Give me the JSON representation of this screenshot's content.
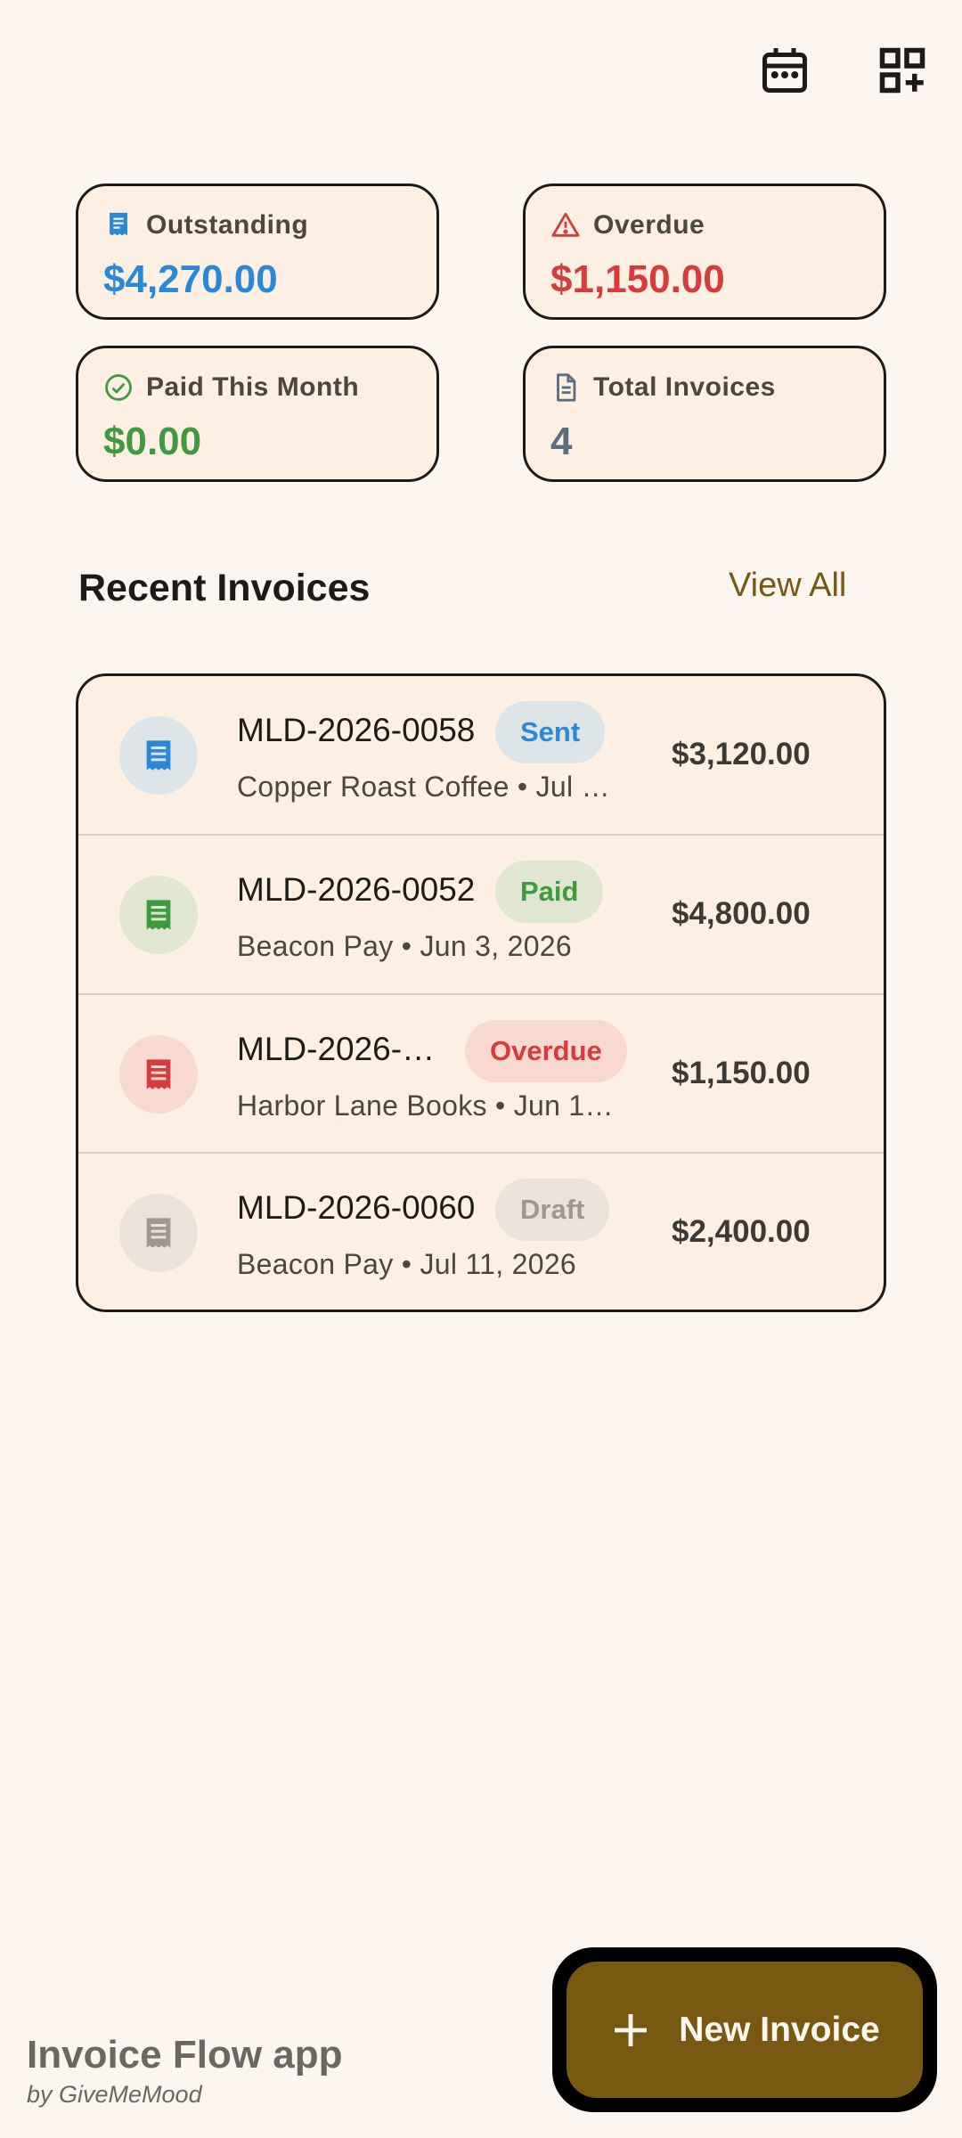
{
  "toolbar": {
    "calendar_icon": "calendar-icon",
    "add_widget_icon": "dashboard-add-icon"
  },
  "stats": {
    "outstanding": {
      "label": "Outstanding",
      "value": "$4,270.00",
      "icon": "receipt-icon",
      "color": "#2a88d8"
    },
    "overdue": {
      "label": "Overdue",
      "value": "$1,150.00",
      "icon": "warning-icon",
      "color": "#d83b3b"
    },
    "paid": {
      "label": "Paid This Month",
      "value": "$0.00",
      "icon": "check-circle-icon",
      "color": "#3f9a41"
    },
    "total": {
      "label": "Total Invoices",
      "value": "4",
      "icon": "document-icon",
      "color": "#5a6e80"
    }
  },
  "recent": {
    "title": "Recent Invoices",
    "view_all": "View All"
  },
  "invoices": [
    {
      "number": "MLD-2026-0058",
      "status": "Sent",
      "subtitle": "Copper Roast Coffee • Jul …",
      "amount": "$3,120.00",
      "color": "#2a88d8",
      "bg": "#dde4e8"
    },
    {
      "number": "MLD-2026-0052",
      "status": "Paid",
      "subtitle": "Beacon Pay • Jun 3, 2026",
      "amount": "$4,800.00",
      "color": "#3f9a41",
      "bg": "#e0e6cf"
    },
    {
      "number": "MLD-2026-0…",
      "status": "Overdue",
      "subtitle": "Harbor Lane Books • Jun 1…",
      "amount": "$1,150.00",
      "color": "#d83b3b",
      "bg": "#f7d9d0"
    },
    {
      "number": "MLD-2026-0060",
      "status": "Draft",
      "subtitle": "Beacon Pay • Jul 11, 2026",
      "amount": "$2,400.00",
      "color": "#9d9891",
      "bg": "#ebe3d9"
    }
  ],
  "fab": {
    "label": "New Invoice",
    "icon": "plus-icon"
  },
  "brand": {
    "title": "Invoice Flow app",
    "subtitle": "by GiveMeMood"
  }
}
